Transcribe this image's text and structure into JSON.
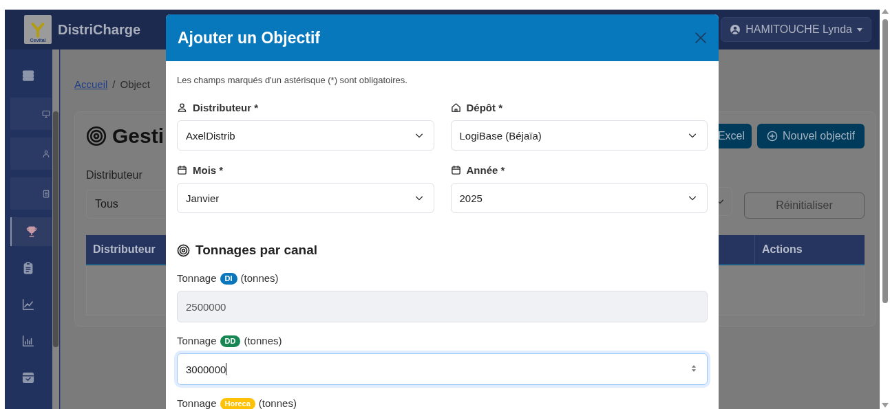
{
  "navbar": {
    "brand": "DistriCharge",
    "logo_text": "Cevital",
    "user": "HAMITOUCHE Lynda"
  },
  "sidebar": {
    "items": [
      {
        "kind": "plain",
        "selected": false
      },
      {
        "kind": "boxed",
        "selected": false
      },
      {
        "kind": "boxed",
        "selected": false
      },
      {
        "kind": "boxed",
        "selected": false
      },
      {
        "kind": "plain",
        "selected": true
      },
      {
        "kind": "plain",
        "selected": false
      },
      {
        "kind": "plain",
        "selected": false
      },
      {
        "kind": "plain",
        "selected": false
      },
      {
        "kind": "plain",
        "selected": false
      }
    ]
  },
  "breadcrumb": {
    "items": [
      {
        "label": "Accueil",
        "kind": "link"
      },
      {
        "label": "Object",
        "kind": "current"
      }
    ],
    "separator": "/"
  },
  "page": {
    "title": "Gesti",
    "buttons": [
      {
        "label": "Excel",
        "kind": "export"
      },
      {
        "label": "Nouvel objectif",
        "kind": "add"
      }
    ],
    "filter": {
      "label": "Distributeur",
      "value": "Tous"
    },
    "reset_button": "Réinitialiser",
    "table": {
      "columns": [
        "Distributeur",
        "Actions"
      ]
    }
  },
  "modal": {
    "title": "Ajouter un Objectif",
    "note": "Les champs marqués d'un astérisque (*) sont obligatoires.",
    "fields": [
      {
        "label": "Distributeur *",
        "value": "AxelDistrib"
      },
      {
        "label": "Dépôt *",
        "value": "LogiBase (Béjaïa)"
      },
      {
        "label": "Mois *",
        "value": "Janvier"
      },
      {
        "label": "Année *",
        "value": "2025"
      }
    ],
    "section_title": "Tonnages par canal",
    "channels": [
      {
        "label": "Tonnage",
        "badge": "DI",
        "color": "#0a77bd",
        "unit": "(tonnes)",
        "value": "2500000",
        "disabled": true,
        "focused": false
      },
      {
        "label": "Tonnage",
        "badge": "DD",
        "color": "#198754",
        "unit": "(tonnes)",
        "value": "3000000",
        "disabled": false,
        "focused": true
      },
      {
        "label": "Tonnage",
        "badge": "Horeca",
        "color": "#ffc107",
        "unit": "(tonnes)"
      }
    ]
  }
}
